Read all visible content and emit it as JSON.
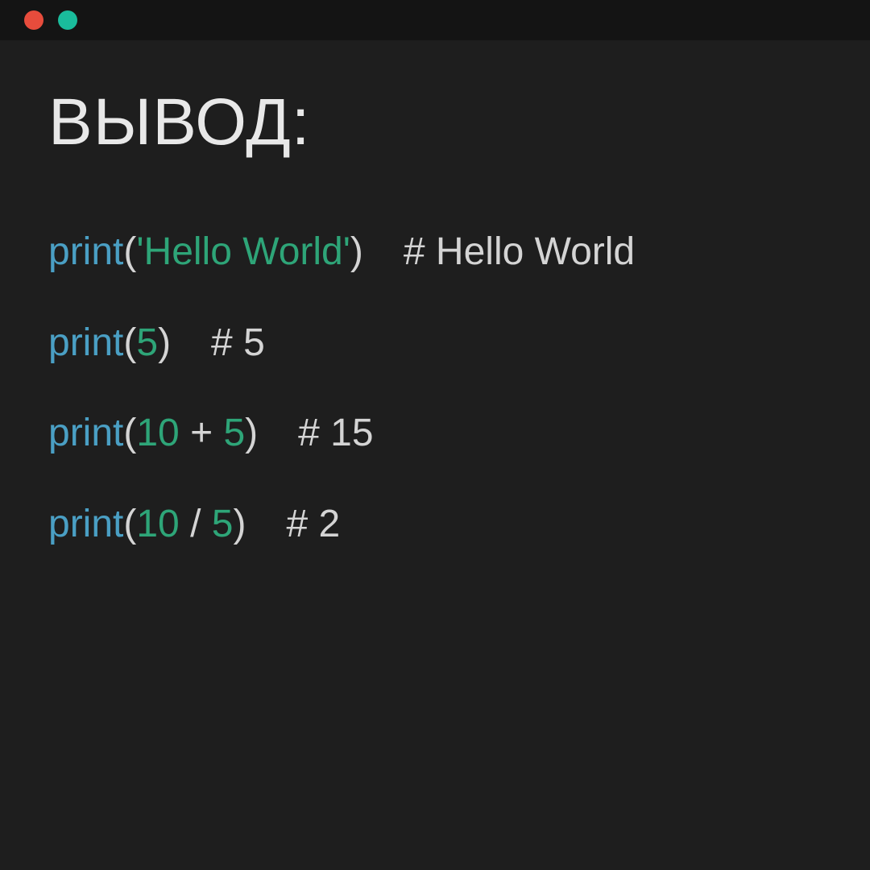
{
  "heading": "ВЫВОД:",
  "lines": [
    {
      "func": "print",
      "openParen": "(",
      "arg_string_open": "'",
      "arg_string_text": "Hello World",
      "arg_string_close": "'",
      "closeParen": ")",
      "comment": "# Hello World"
    },
    {
      "func": "print",
      "openParen": "(",
      "arg_num": "5",
      "closeParen": ")",
      "comment": "# 5"
    },
    {
      "func": "print",
      "openParen": "(",
      "arg_left": "10",
      "arg_op": " + ",
      "arg_right": "5",
      "closeParen": ")",
      "comment": "# 15"
    },
    {
      "func": "print",
      "openParen": "(",
      "arg_left": "10",
      "arg_op": " / ",
      "arg_right": "5",
      "closeParen": ")",
      "comment": "# 2"
    }
  ]
}
